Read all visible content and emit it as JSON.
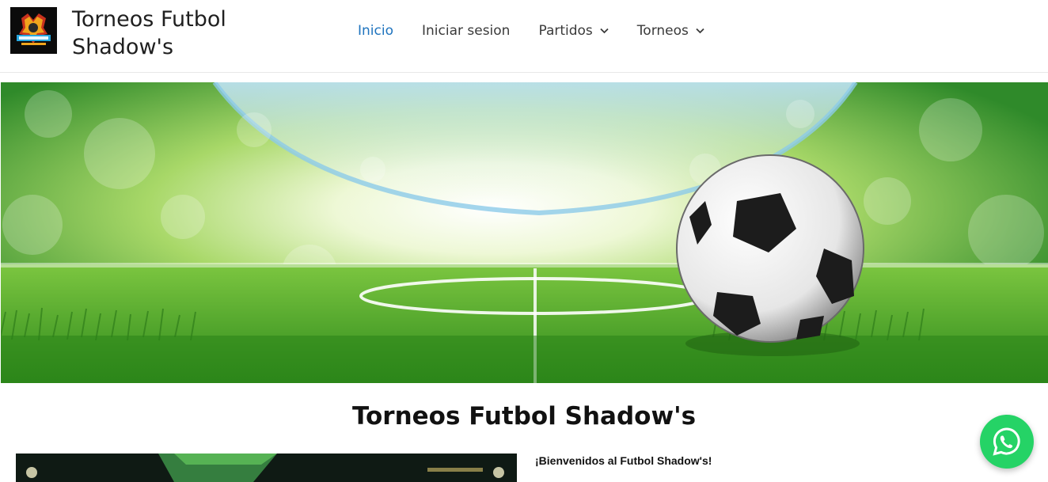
{
  "header": {
    "site_title": "Torneos Futbol Shadow's",
    "logo_icon": "shadows-logo"
  },
  "nav": {
    "items": [
      {
        "label": "Inicio",
        "active": true,
        "has_dropdown": false
      },
      {
        "label": "Iniciar sesion",
        "active": false,
        "has_dropdown": false
      },
      {
        "label": "Partidos",
        "active": false,
        "has_dropdown": true
      },
      {
        "label": "Torneos",
        "active": false,
        "has_dropdown": true
      }
    ]
  },
  "hero": {
    "image": "soccer-stadium-banner"
  },
  "main": {
    "title": "Torneos Futbol Shadow's",
    "welcome": "¡Bienvenidos al Futbol Shadow's!"
  },
  "whatsapp": {
    "icon": "whatsapp-icon",
    "color": "#25d366"
  },
  "colors": {
    "accent": "#1e73be",
    "nav_text": "#3a3a3a"
  }
}
